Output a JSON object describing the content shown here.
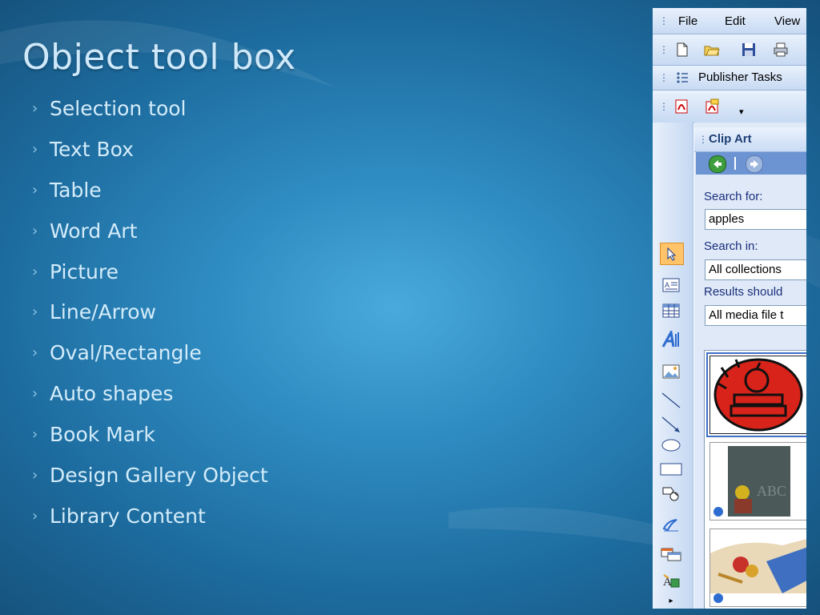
{
  "slide": {
    "title": "Object tool box",
    "bullets": [
      "Selection tool",
      "Text Box",
      "Table",
      "Word Art",
      "Picture",
      "Line/Arrow",
      "Oval/Rectangle",
      "Auto shapes",
      "Book Mark",
      "Design Gallery Object",
      "Library Content"
    ]
  },
  "screenshot": {
    "menu": [
      "File",
      "Edit",
      "View"
    ],
    "toolbar_tasks_label": "Publisher Tasks",
    "clipart": {
      "title": "Clip Art",
      "search_for_label": "Search for:",
      "search_value": "apples",
      "search_in_label": "Search in:",
      "search_in_value": "All collections",
      "results_label": "Results should",
      "results_value": "All media file t"
    },
    "icons": {
      "tools": [
        "selection-arrow-icon",
        "text-box-icon",
        "table-icon",
        "word-art-icon",
        "picture-icon",
        "line-icon",
        "arrow-icon",
        "oval-icon",
        "rectangle-icon",
        "auto-shapes-icon",
        "bookmark-icon",
        "design-gallery-icon",
        "library-content-icon"
      ]
    },
    "colors": {
      "active_tool": "#ffc36a",
      "nav_bar": "#6d94d2",
      "label_blue": "#1b2f7a"
    }
  }
}
